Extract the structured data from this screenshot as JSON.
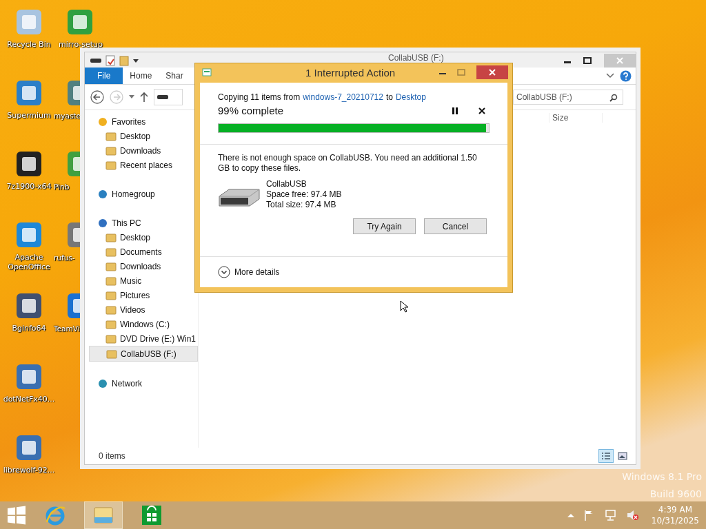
{
  "desktop": {
    "icons": [
      {
        "label": "Recycle Bin"
      },
      {
        "label": "Supermium"
      },
      {
        "label": "7z1900-x64"
      },
      {
        "label": "Apache OpenOffice"
      },
      {
        "label": "Bginfo64"
      },
      {
        "label": "dotNetFx40..."
      },
      {
        "label": "librewolf-92..."
      },
      {
        "label": "mirro-setup"
      },
      {
        "label": "myaste"
      },
      {
        "label": "Pinb"
      },
      {
        "label": "rufus-"
      },
      {
        "label": "TeamVi"
      }
    ],
    "edition": "Windows 8.1 Pro",
    "build": "Build 9600"
  },
  "explorer": {
    "title": "CollabUSB (F:)",
    "ribbon_tabs": [
      {
        "label": "File",
        "selected": true
      },
      {
        "label": "Home",
        "selected": false
      },
      {
        "label": "Shar",
        "selected": false
      }
    ],
    "search": {
      "placeholder": "CollabUSB (F:)"
    },
    "columns": [
      "Size"
    ],
    "nav": [
      {
        "label": "Favorites",
        "children": [
          {
            "label": "Desktop",
            "selected": false
          },
          {
            "label": "Downloads",
            "selected": false
          },
          {
            "label": "Recent places",
            "selected": false
          }
        ]
      },
      {
        "label": "Homegroup"
      },
      {
        "label": "This PC",
        "children": [
          {
            "label": "Desktop",
            "selected": false
          },
          {
            "label": "Documents",
            "selected": false
          },
          {
            "label": "Downloads",
            "selected": false
          },
          {
            "label": "Music",
            "selected": false
          },
          {
            "label": "Pictures",
            "selected": false
          },
          {
            "label": "Videos",
            "selected": false
          },
          {
            "label": "Windows (C:)",
            "selected": false
          },
          {
            "label": "DVD Drive (E:) Win1",
            "selected": false
          },
          {
            "label": "CollabUSB (F:)",
            "selected": true
          }
        ]
      },
      {
        "label": "Network"
      }
    ],
    "status": "0 items",
    "views": [
      {
        "kind": "details",
        "selected": true
      },
      {
        "kind": "large",
        "selected": false
      }
    ]
  },
  "dialog": {
    "title": "1 Interrupted Action",
    "copy_prefix": "Copying 11 items from",
    "source": "windows-7_20210712",
    "copy_mid": "to",
    "destination": "Desktop",
    "progress_label": "99% complete",
    "level": 0.99,
    "message": "There is not enough space on CollabUSB. You need an additional 1.50 GB to copy these files.",
    "drive": {
      "name": "CollabUSB",
      "free": "Space free: 97.4 MB",
      "total": "Total size: 97.4 MB"
    },
    "buttons": [
      "Try Again",
      "Cancel"
    ],
    "more": "More details"
  },
  "taskbar": {
    "apps": [
      {
        "kind": "ie",
        "active": false
      },
      {
        "kind": "explorer",
        "active": true
      },
      {
        "kind": "store",
        "active": false
      }
    ],
    "time": "4:39 AM",
    "date": "10/31/2025"
  }
}
